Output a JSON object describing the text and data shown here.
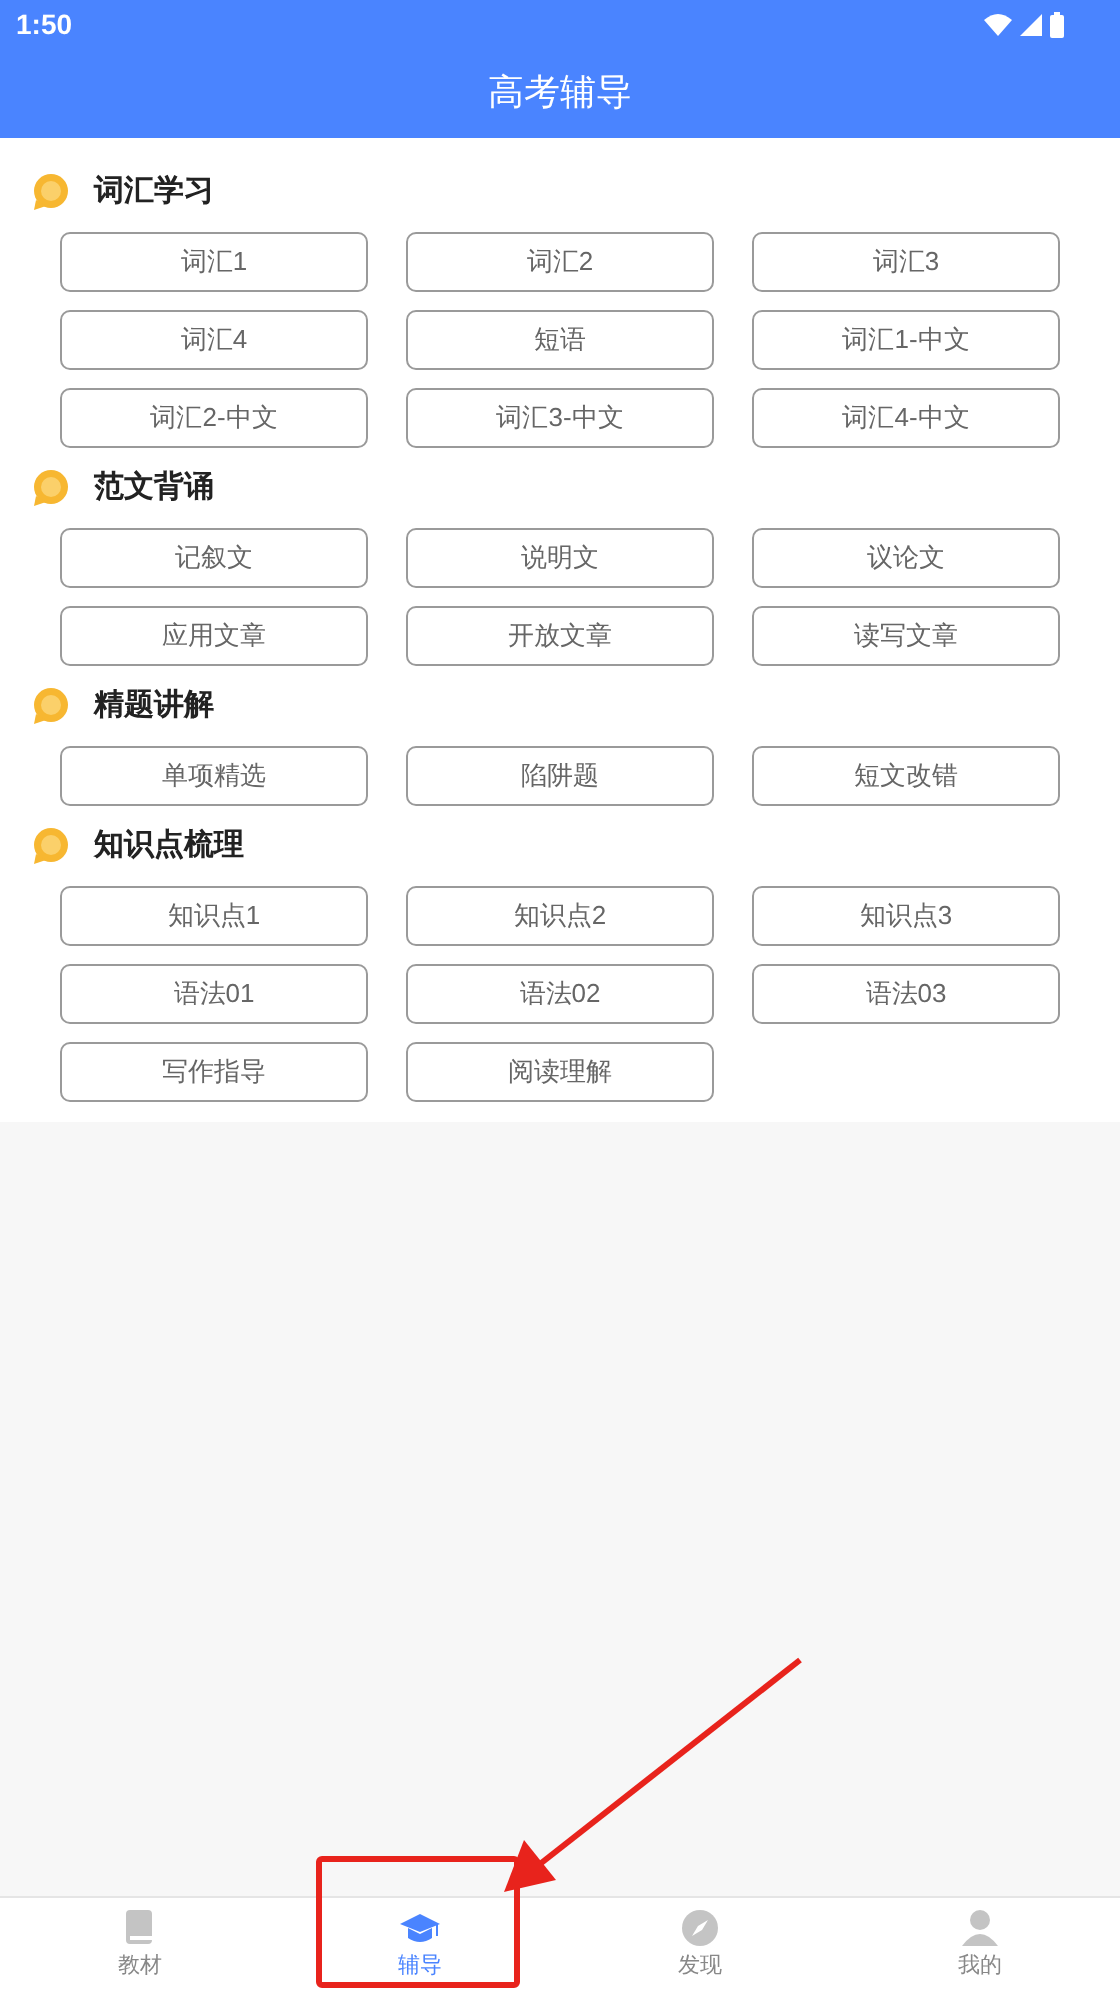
{
  "status_bar": {
    "time": "1:50"
  },
  "header": {
    "title": "高考辅导"
  },
  "sections": [
    {
      "title": "词汇学习",
      "items": [
        "词汇1",
        "词汇2",
        "词汇3",
        "词汇4",
        "短语",
        "词汇1-中文",
        "词汇2-中文",
        "词汇3-中文",
        "词汇4-中文"
      ]
    },
    {
      "title": "范文背诵",
      "items": [
        "记叙文",
        "说明文",
        "议论文",
        "应用文章",
        "开放文章",
        "读写文章"
      ]
    },
    {
      "title": "精题讲解",
      "items": [
        "单项精选",
        "陷阱题",
        "短文改错"
      ]
    },
    {
      "title": "知识点梳理",
      "items": [
        "知识点1",
        "知识点2",
        "知识点3",
        "语法01",
        "语法02",
        "语法03",
        "写作指导",
        "阅读理解"
      ]
    }
  ],
  "bottom_nav": [
    {
      "label": "教材",
      "kind": "book",
      "selected": false,
      "highlighted": false
    },
    {
      "label": "辅导",
      "kind": "cap",
      "selected": true,
      "highlighted": true
    },
    {
      "label": "发现",
      "kind": "compass",
      "selected": false,
      "highlighted": false
    },
    {
      "label": "我的",
      "kind": "person",
      "selected": false,
      "highlighted": false
    }
  ]
}
